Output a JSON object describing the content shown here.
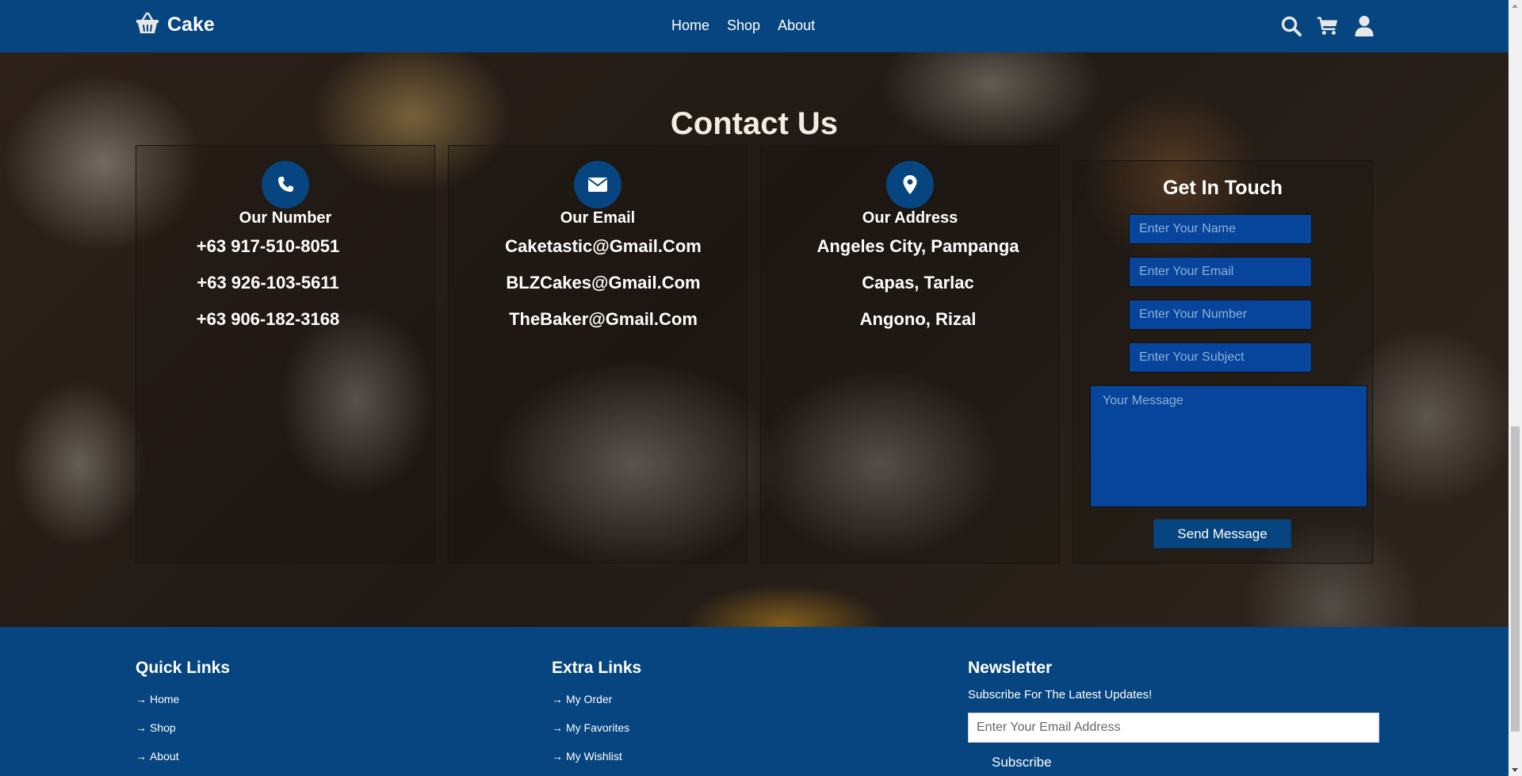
{
  "header": {
    "brand": "Cake",
    "nav": [
      "Home",
      "Shop",
      "About"
    ]
  },
  "contact": {
    "title": "Contact Us",
    "cards": [
      {
        "icon": "phone-icon",
        "title": "Our Number",
        "lines": [
          "+63 917-510-8051",
          "+63 926-103-5611",
          "+63 906-182-3168"
        ]
      },
      {
        "icon": "envelope-icon",
        "title": "Our Email",
        "lines": [
          "Caketastic@Gmail.Com",
          "BLZCakes@Gmail.Com",
          "TheBaker@Gmail.Com"
        ]
      },
      {
        "icon": "map-marker-icon",
        "title": "Our Address",
        "lines": [
          "Angeles City, Pampanga",
          "Capas, Tarlac",
          "Angono, Rizal"
        ]
      }
    ],
    "form": {
      "title": "Get In Touch",
      "name_placeholder": "Enter Your Name",
      "email_placeholder": "Enter Your Email",
      "number_placeholder": "Enter Your Number",
      "subject_placeholder": "Enter Your Subject",
      "message_placeholder": "Your Message",
      "send_label": "Send Message"
    }
  },
  "footer": {
    "quick_links": {
      "title": "Quick Links",
      "items": [
        "Home",
        "Shop",
        "About"
      ]
    },
    "extra_links": {
      "title": "Extra Links",
      "items": [
        "My Order",
        "My Favorites",
        "My Wishlist"
      ]
    },
    "newsletter": {
      "title": "Newsletter",
      "subtitle": "Subscribe For The Latest Updates!",
      "email_placeholder": "Enter Your Email Address",
      "button": "Subscribe"
    }
  },
  "colors": {
    "primary": "#06457f",
    "input_bg": "#06459b"
  }
}
